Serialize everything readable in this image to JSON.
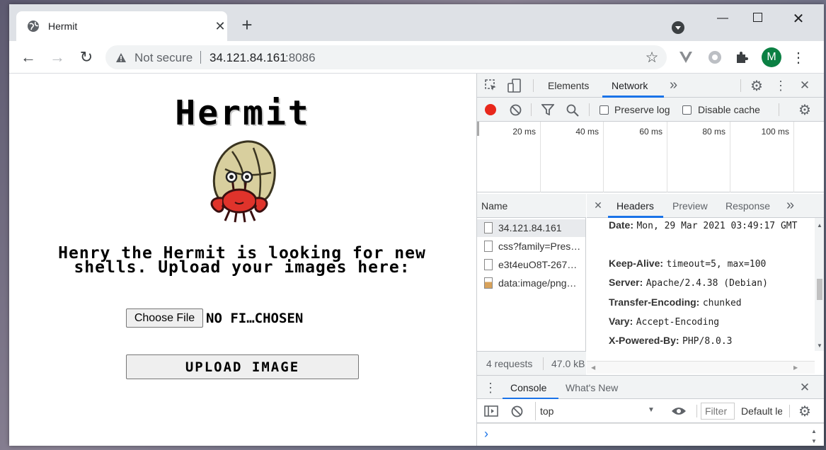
{
  "browser": {
    "tab_title": "Hermit",
    "address_security": "Not secure",
    "address_host": "34.121.84.161",
    "address_port": ":8086",
    "profile_initial": "M"
  },
  "page": {
    "title": "Hermit",
    "description": "Henry the Hermit is looking for new shells. Upload your images here:",
    "choose_file_label": "Choose File",
    "file_status": "NO FI…CHOSEN",
    "upload_button": "UPLOAD IMAGE"
  },
  "devtools": {
    "tabs": [
      "Elements",
      "Network"
    ],
    "more": "»",
    "preserve_log": "Preserve log",
    "disable_cache": "Disable cache",
    "timeline_ticks": [
      "20 ms",
      "40 ms",
      "60 ms",
      "80 ms",
      "100 ms"
    ],
    "name_header": "Name",
    "requests": [
      {
        "name": "34.121.84.161",
        "selected": true
      },
      {
        "name": "css?family=Pres…",
        "selected": false
      },
      {
        "name": "e3t4euO8T-267…",
        "selected": false
      },
      {
        "name": "data:image/png…",
        "selected": false
      }
    ],
    "summary_requests": "4 requests",
    "summary_size": "47.0 kB",
    "detail_tabs": [
      "Headers",
      "Preview",
      "Response"
    ],
    "headers": [
      {
        "name": "Date:",
        "value": "Mon, 29 Mar 2021 03:49:17 GMT"
      },
      {
        "name": "Keep-Alive:",
        "value": "timeout=5, max=100"
      },
      {
        "name": "Server:",
        "value": "Apache/2.4.38 (Debian)"
      },
      {
        "name": "Transfer-Encoding:",
        "value": "chunked"
      },
      {
        "name": "Vary:",
        "value": "Accept-Encoding"
      },
      {
        "name": "X-Powered-By:",
        "value": "PHP/8.0.3"
      }
    ],
    "drawer_tabs": [
      "Console",
      "What's New"
    ],
    "console_context": "top",
    "filter_placeholder": "Filter",
    "default_levels": "Default levels",
    "prompt": "›"
  },
  "colors": {
    "record": "#e8271b",
    "tab_active_underline": "#1a73e8",
    "avatar": "#0b8043",
    "crab_red": "#e0332b",
    "shell": "#d8cf9e"
  }
}
